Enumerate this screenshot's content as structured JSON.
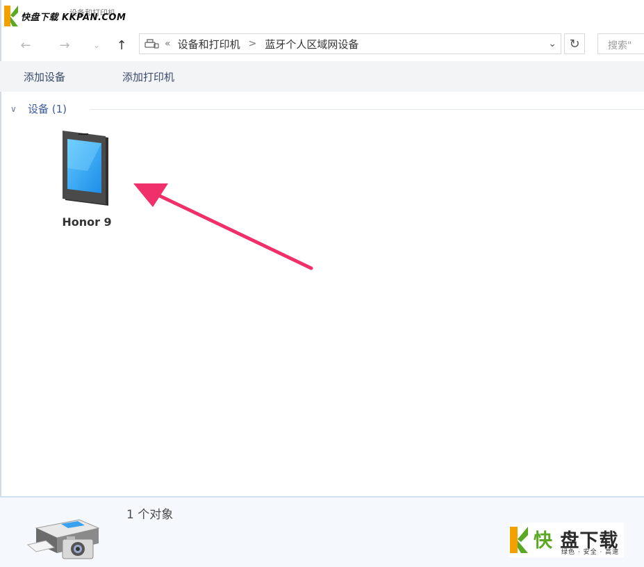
{
  "watermark": {
    "text": "快盘下载 KKPAN.COM"
  },
  "window": {
    "title": "设备和打印机"
  },
  "nav": {
    "back_icon": "arrow-left-icon",
    "forward_icon": "arrow-right-icon",
    "recent_icon": "chevron-down-icon",
    "up_icon": "arrow-up-icon"
  },
  "address": {
    "overflow": "«",
    "crumbs": [
      "设备和打印机",
      "蓝牙个人区域网设备"
    ],
    "separator": ">"
  },
  "search": {
    "placeholder": "搜索\""
  },
  "commands": {
    "add_device": "添加设备",
    "add_printer": "添加打印机"
  },
  "group": {
    "title": "设备 (1)"
  },
  "devices": [
    {
      "name": "Honor 9",
      "icon": "smartphone-icon"
    }
  ],
  "status": {
    "count": "1 个对象"
  },
  "brand_watermark": {
    "main_accent": "快",
    "main_rest": " 盘下载",
    "sub": "绿色 · 安全 · 高速"
  },
  "colors": {
    "accent_arrow": "#f0306a",
    "group_title": "#3c5b9e",
    "brand_green": "#5aa823",
    "brand_orange": "#f2a100"
  }
}
